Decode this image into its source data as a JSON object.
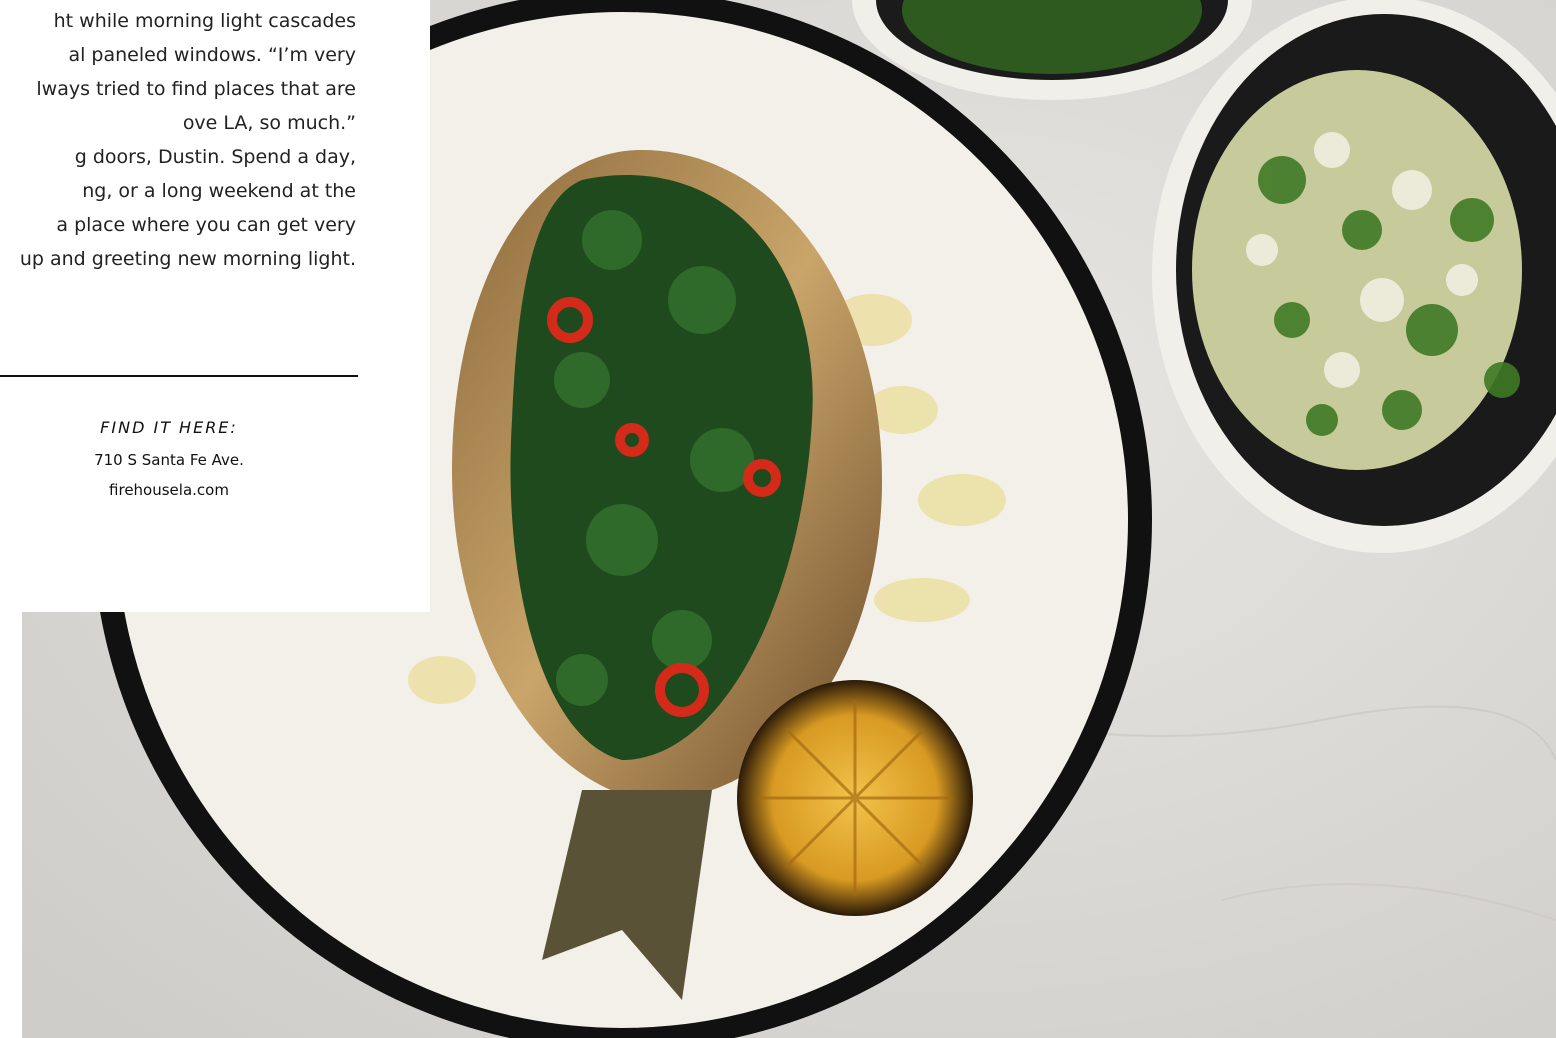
{
  "article": {
    "body_lines": [
      "ht while morning light cascades",
      "al paneled windows. “I’m very",
      "lways tried to find places that are",
      "ove LA, so much.”",
      "g doors, Dustin. Spend a day,",
      "ng, or a long weekend at the",
      " a place where you can get very",
      "up and greeting new morning light."
    ]
  },
  "find_it_here": {
    "label": "FIND IT HERE:",
    "address": "710 S Santa Fe Ave.",
    "website": "firehousela.com"
  },
  "colors": {
    "plate_rim": "#111111",
    "plate": "#f3f0ea",
    "marble": "#dedcd8",
    "herbs": "#1f4a1e",
    "lemon": "#e3a024"
  }
}
